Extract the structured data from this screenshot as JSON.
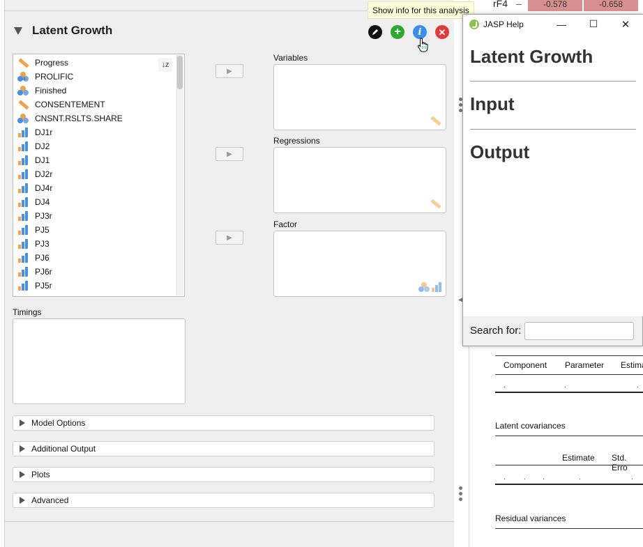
{
  "tooltip": "Show info for this analysis",
  "analysis": {
    "title": "Latent Growth",
    "header_icons": [
      "edit-icon",
      "add-icon",
      "info-icon",
      "close-icon"
    ]
  },
  "variables": [
    {
      "name": "Progress",
      "type": "scale"
    },
    {
      "name": "PROLIFIC",
      "type": "nominal-text"
    },
    {
      "name": "Finished",
      "type": "nominal"
    },
    {
      "name": "CONSENTEMENT",
      "type": "scale"
    },
    {
      "name": "CNSNT.RSLTS.SHARE",
      "type": "nominal"
    },
    {
      "name": "DJ1r",
      "type": "ordinal"
    },
    {
      "name": "DJ2",
      "type": "ordinal"
    },
    {
      "name": "DJ1",
      "type": "ordinal"
    },
    {
      "name": "DJ2r",
      "type": "ordinal"
    },
    {
      "name": "DJ4r",
      "type": "ordinal"
    },
    {
      "name": "DJ4",
      "type": "ordinal"
    },
    {
      "name": "PJ3r",
      "type": "ordinal"
    },
    {
      "name": "PJ5",
      "type": "ordinal"
    },
    {
      "name": "PJ3",
      "type": "ordinal"
    },
    {
      "name": "PJ6",
      "type": "ordinal"
    },
    {
      "name": "PJ6r",
      "type": "ordinal"
    },
    {
      "name": "PJ5r",
      "type": "ordinal"
    }
  ],
  "boxes": {
    "variables": "Variables",
    "regressions": "Regressions",
    "factor": "Factor",
    "timings": "Timings"
  },
  "sections": [
    "Model Options",
    "Additional Output",
    "Plots",
    "Advanced"
  ],
  "output": {
    "top_row_label": "rF4",
    "top_row_values": [
      "-0.578",
      "-0.658"
    ],
    "table1_headers": [
      "Component",
      "Parameter",
      "Estima"
    ],
    "latent_cov_title": "Latent covariances",
    "table2_headers": [
      "Estimate",
      "Std. Erro"
    ],
    "residual_title": "Residual variances"
  },
  "help": {
    "window_title": "JASP Help",
    "headings": [
      "Latent Growth",
      "Input",
      "Output"
    ],
    "search_label": "Search for:"
  },
  "colors": {
    "pane_bg": "#efefef",
    "info_blue": "#3a8fe8",
    "add_green": "#2ea82e",
    "close_red": "#e03a3a",
    "scale_orange": "#f0a34a",
    "cell_red": "#d98f8f"
  }
}
